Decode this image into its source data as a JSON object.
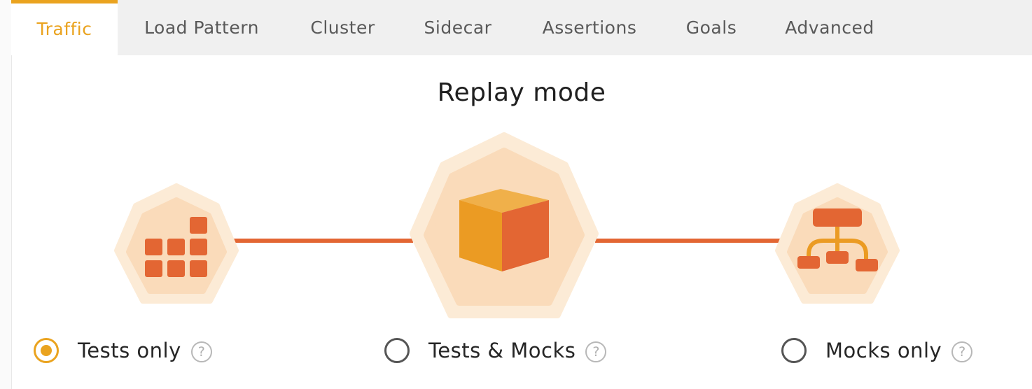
{
  "tabs": [
    {
      "label": "Traffic",
      "active": true
    },
    {
      "label": "Load Pattern",
      "active": false
    },
    {
      "label": "Cluster",
      "active": false
    },
    {
      "label": "Sidecar",
      "active": false
    },
    {
      "label": "Assertions",
      "active": false
    },
    {
      "label": "Goals",
      "active": false
    },
    {
      "label": "Advanced",
      "active": false
    }
  ],
  "replay": {
    "title": "Replay mode",
    "options": [
      {
        "label": "Tests only",
        "selected": true,
        "icon": "grid-blocks-icon",
        "help": "?"
      },
      {
        "label": "Tests & Mocks",
        "selected": false,
        "icon": "cube-icon",
        "help": "?"
      },
      {
        "label": "Mocks only",
        "selected": false,
        "icon": "hierarchy-icon",
        "help": "?"
      }
    ]
  },
  "colors": {
    "accent": "#eaa31f",
    "connector": "#e36633",
    "hex_outer": "#fcebd6",
    "hex_inner": "#fadbba",
    "icon_orange": "#e36633",
    "cube_left": "#eb9b23",
    "cube_top": "#f0b04a"
  }
}
